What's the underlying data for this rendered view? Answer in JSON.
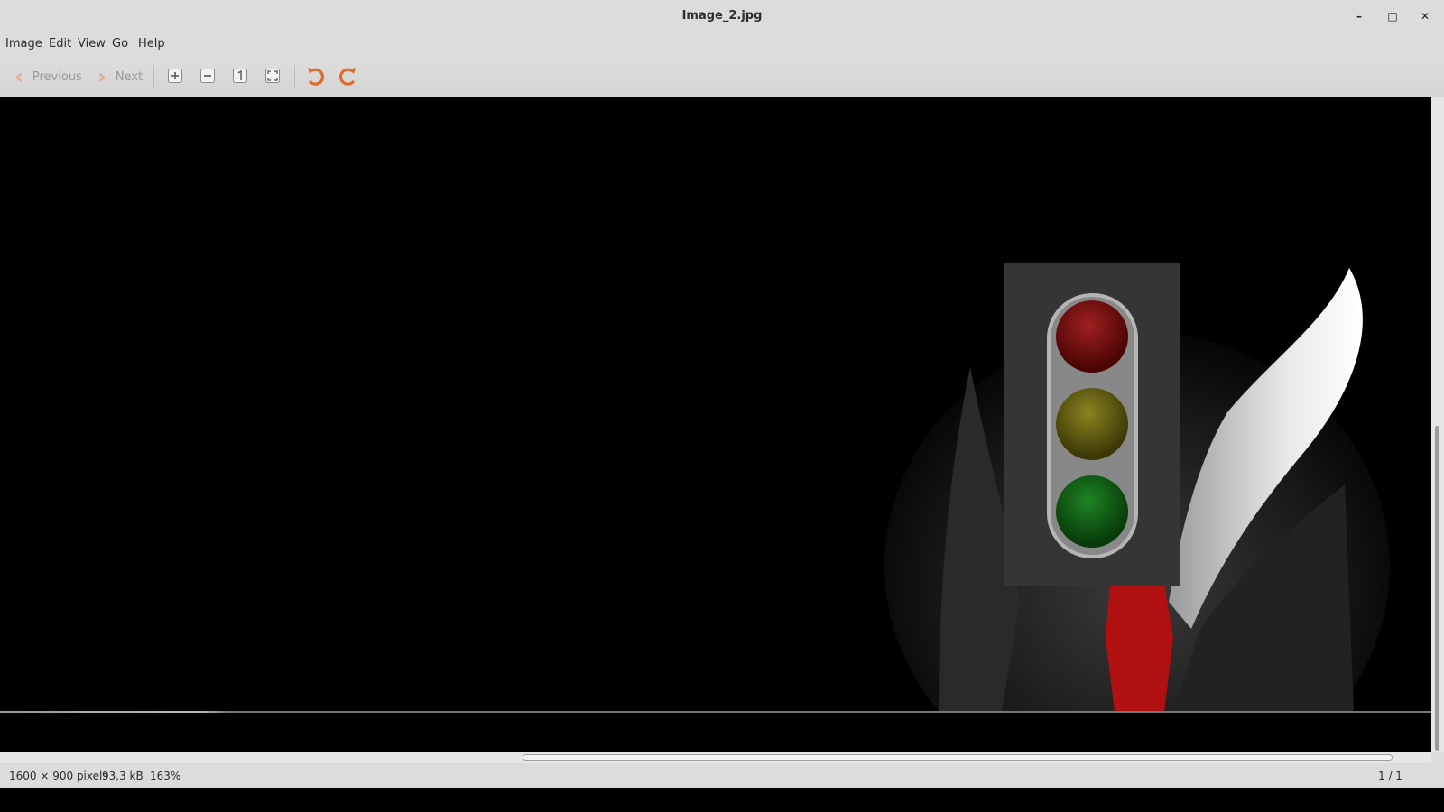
{
  "window": {
    "title": "Image_2.jpg",
    "controls": {
      "minimize": "–",
      "maximize": "□",
      "close": "✕"
    }
  },
  "menubar": {
    "items": [
      "Image",
      "Edit",
      "View",
      "Go",
      "Help"
    ]
  },
  "toolbar": {
    "previous_label": "Previous",
    "next_label": "Next",
    "icons": [
      "zoom-in-icon",
      "zoom-out-icon",
      "zoom-normal-icon",
      "zoom-fit-icon",
      "rotate-left-icon",
      "rotate-right-icon"
    ]
  },
  "image": {
    "description_icons": [
      "traffic-light"
    ],
    "colors": {
      "housing": "#3a3a3a",
      "red": "#7a0a0a",
      "yellow": "#6b6410",
      "green": "#0f5a12",
      "tie": "#b01010"
    }
  },
  "scrollbars": {
    "vertical_position": 0.5,
    "horizontal_position": 0.62
  },
  "statusbar": {
    "dimensions": "1600 × 900 pixels",
    "file_size": "93,3 kB",
    "zoom": "163%",
    "page": "1 / 1"
  }
}
